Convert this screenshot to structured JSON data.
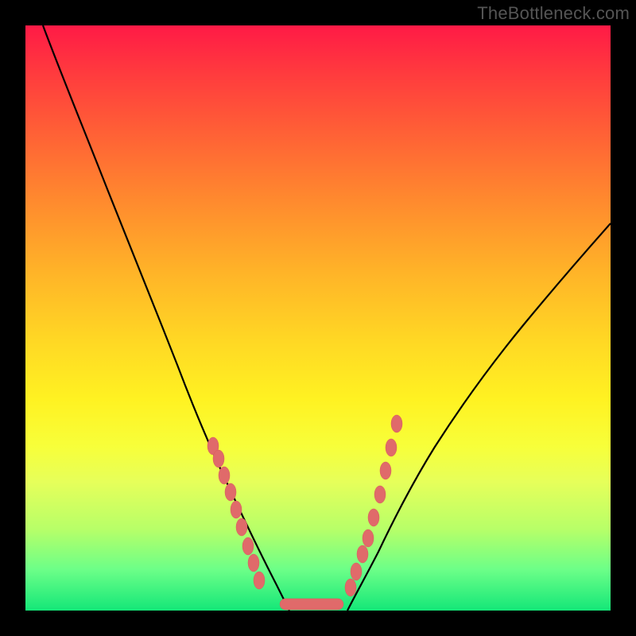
{
  "watermark": "TheBottleneck.com",
  "chart_data": {
    "type": "line",
    "title": "",
    "xlabel": "",
    "ylabel": "",
    "xlim": [
      0,
      100
    ],
    "ylim": [
      0,
      100
    ],
    "grid": false,
    "legend": false,
    "background_gradient": {
      "top": "#ff1a46",
      "bottom": "#14e778"
    },
    "series": [
      {
        "name": "left-curve",
        "stroke": "#000000",
        "x": [
          3,
          6,
          10,
          14,
          18,
          22,
          26,
          30,
          33,
          36,
          38,
          40,
          42,
          44,
          45
        ],
        "y": [
          100,
          92,
          82,
          72,
          62,
          52,
          42,
          33,
          25,
          18,
          12,
          8,
          5,
          2,
          0
        ]
      },
      {
        "name": "right-curve",
        "stroke": "#000000",
        "x": [
          55,
          56,
          58,
          60,
          62,
          65,
          70,
          76,
          83,
          91,
          100
        ],
        "y": [
          0,
          2,
          5,
          8,
          12,
          18,
          27,
          38,
          50,
          62,
          74
        ]
      }
    ],
    "markers": [
      {
        "name": "left-dots",
        "color": "#e06a6a",
        "x": [
          32,
          33,
          34,
          35,
          36,
          37,
          38,
          39,
          40
        ],
        "y": [
          28,
          26,
          23,
          20,
          17,
          14,
          11,
          8,
          5
        ]
      },
      {
        "name": "right-dots",
        "color": "#e06a6a",
        "x": [
          55,
          56,
          57,
          58,
          59,
          60,
          61,
          62,
          63
        ],
        "y": [
          4,
          6,
          9,
          12,
          16,
          20,
          24,
          28,
          32
        ]
      },
      {
        "name": "bottom-bar",
        "color": "#e06a6a",
        "x": [
          44,
          46,
          48,
          50,
          52,
          54
        ],
        "y": [
          0.5,
          0.5,
          0.5,
          0.5,
          0.5,
          0.5
        ]
      }
    ]
  }
}
